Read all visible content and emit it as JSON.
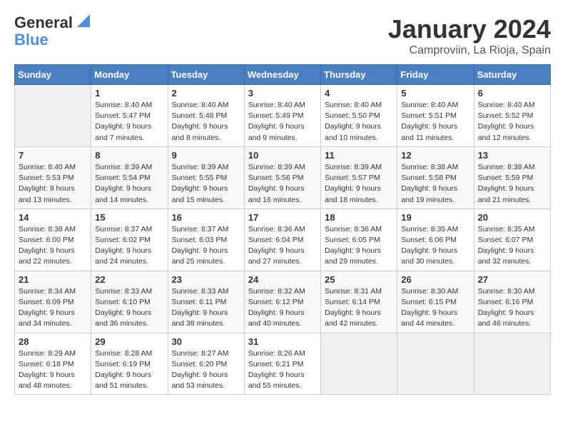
{
  "logo": {
    "line1": "General",
    "line2": "Blue"
  },
  "title": "January 2024",
  "subtitle": "Camproviin, La Rioja, Spain",
  "days_of_week": [
    "Sunday",
    "Monday",
    "Tuesday",
    "Wednesday",
    "Thursday",
    "Friday",
    "Saturday"
  ],
  "weeks": [
    [
      {
        "day": "",
        "info": ""
      },
      {
        "day": "1",
        "info": "Sunrise: 8:40 AM\nSunset: 5:47 PM\nDaylight: 9 hours\nand 7 minutes."
      },
      {
        "day": "2",
        "info": "Sunrise: 8:40 AM\nSunset: 5:48 PM\nDaylight: 9 hours\nand 8 minutes."
      },
      {
        "day": "3",
        "info": "Sunrise: 8:40 AM\nSunset: 5:49 PM\nDaylight: 9 hours\nand 9 minutes."
      },
      {
        "day": "4",
        "info": "Sunrise: 8:40 AM\nSunset: 5:50 PM\nDaylight: 9 hours\nand 10 minutes."
      },
      {
        "day": "5",
        "info": "Sunrise: 8:40 AM\nSunset: 5:51 PM\nDaylight: 9 hours\nand 11 minutes."
      },
      {
        "day": "6",
        "info": "Sunrise: 8:40 AM\nSunset: 5:52 PM\nDaylight: 9 hours\nand 12 minutes."
      }
    ],
    [
      {
        "day": "7",
        "info": "Sunrise: 8:40 AM\nSunset: 5:53 PM\nDaylight: 9 hours\nand 13 minutes."
      },
      {
        "day": "8",
        "info": "Sunrise: 8:39 AM\nSunset: 5:54 PM\nDaylight: 9 hours\nand 14 minutes."
      },
      {
        "day": "9",
        "info": "Sunrise: 8:39 AM\nSunset: 5:55 PM\nDaylight: 9 hours\nand 15 minutes."
      },
      {
        "day": "10",
        "info": "Sunrise: 8:39 AM\nSunset: 5:56 PM\nDaylight: 9 hours\nand 16 minutes."
      },
      {
        "day": "11",
        "info": "Sunrise: 8:39 AM\nSunset: 5:57 PM\nDaylight: 9 hours\nand 18 minutes."
      },
      {
        "day": "12",
        "info": "Sunrise: 8:38 AM\nSunset: 5:58 PM\nDaylight: 9 hours\nand 19 minutes."
      },
      {
        "day": "13",
        "info": "Sunrise: 8:38 AM\nSunset: 5:59 PM\nDaylight: 9 hours\nand 21 minutes."
      }
    ],
    [
      {
        "day": "14",
        "info": "Sunrise: 8:38 AM\nSunset: 6:00 PM\nDaylight: 9 hours\nand 22 minutes."
      },
      {
        "day": "15",
        "info": "Sunrise: 8:37 AM\nSunset: 6:02 PM\nDaylight: 9 hours\nand 24 minutes."
      },
      {
        "day": "16",
        "info": "Sunrise: 8:37 AM\nSunset: 6:03 PM\nDaylight: 9 hours\nand 25 minutes."
      },
      {
        "day": "17",
        "info": "Sunrise: 8:36 AM\nSunset: 6:04 PM\nDaylight: 9 hours\nand 27 minutes."
      },
      {
        "day": "18",
        "info": "Sunrise: 8:36 AM\nSunset: 6:05 PM\nDaylight: 9 hours\nand 29 minutes."
      },
      {
        "day": "19",
        "info": "Sunrise: 8:35 AM\nSunset: 6:06 PM\nDaylight: 9 hours\nand 30 minutes."
      },
      {
        "day": "20",
        "info": "Sunrise: 8:35 AM\nSunset: 6:07 PM\nDaylight: 9 hours\nand 32 minutes."
      }
    ],
    [
      {
        "day": "21",
        "info": "Sunrise: 8:34 AM\nSunset: 6:09 PM\nDaylight: 9 hours\nand 34 minutes."
      },
      {
        "day": "22",
        "info": "Sunrise: 8:33 AM\nSunset: 6:10 PM\nDaylight: 9 hours\nand 36 minutes."
      },
      {
        "day": "23",
        "info": "Sunrise: 8:33 AM\nSunset: 6:11 PM\nDaylight: 9 hours\nand 38 minutes."
      },
      {
        "day": "24",
        "info": "Sunrise: 8:32 AM\nSunset: 6:12 PM\nDaylight: 9 hours\nand 40 minutes."
      },
      {
        "day": "25",
        "info": "Sunrise: 8:31 AM\nSunset: 6:14 PM\nDaylight: 9 hours\nand 42 minutes."
      },
      {
        "day": "26",
        "info": "Sunrise: 8:30 AM\nSunset: 6:15 PM\nDaylight: 9 hours\nand 44 minutes."
      },
      {
        "day": "27",
        "info": "Sunrise: 8:30 AM\nSunset: 6:16 PM\nDaylight: 9 hours\nand 46 minutes."
      }
    ],
    [
      {
        "day": "28",
        "info": "Sunrise: 8:29 AM\nSunset: 6:18 PM\nDaylight: 9 hours\nand 48 minutes."
      },
      {
        "day": "29",
        "info": "Sunrise: 8:28 AM\nSunset: 6:19 PM\nDaylight: 9 hours\nand 51 minutes."
      },
      {
        "day": "30",
        "info": "Sunrise: 8:27 AM\nSunset: 6:20 PM\nDaylight: 9 hours\nand 53 minutes."
      },
      {
        "day": "31",
        "info": "Sunrise: 8:26 AM\nSunset: 6:21 PM\nDaylight: 9 hours\nand 55 minutes."
      },
      {
        "day": "",
        "info": ""
      },
      {
        "day": "",
        "info": ""
      },
      {
        "day": "",
        "info": ""
      }
    ]
  ]
}
